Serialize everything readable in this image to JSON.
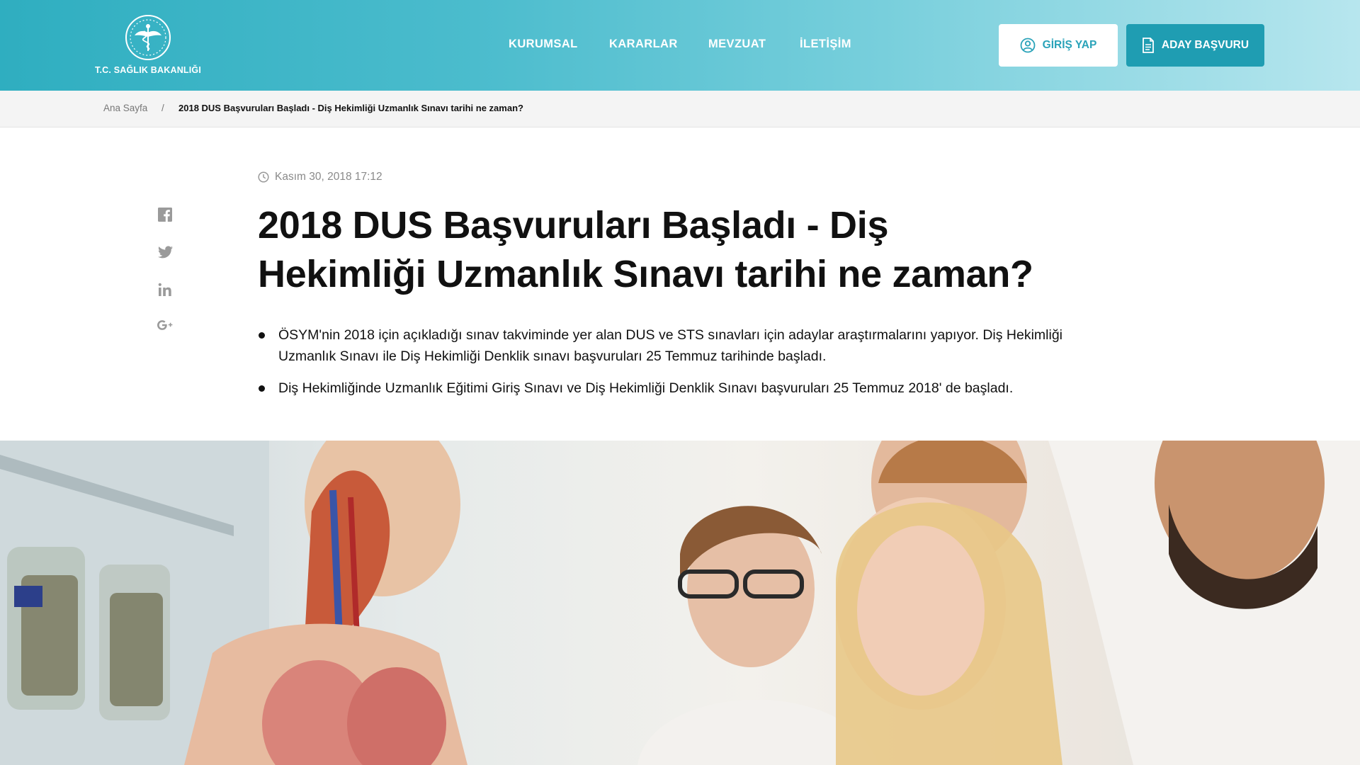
{
  "header": {
    "logo_text": "T.C. SAĞLIK BAKANLIĞI",
    "nav": [
      "KURUMSAL",
      "KARARLAR",
      "MEVZUAT",
      "İLETİŞİM"
    ],
    "login_label": "GİRİŞ YAP",
    "apply_label": "ADAY BAŞVURU"
  },
  "breadcrumb": {
    "home": "Ana Sayfa",
    "separator": "/",
    "current": "2018 DUS Başvuruları Başladı - Diş Hekimliği Uzmanlık Sınavı tarihi ne zaman?"
  },
  "share": [
    "facebook-icon",
    "twitter-icon",
    "linkedin-icon",
    "google-plus-icon"
  ],
  "article": {
    "date": "Kasım 30, 2018 17:12",
    "title": "2018 DUS Başvuruları Başladı - Diş Hekimliği Uzmanlık Sınavı tarihi ne zaman?",
    "bullets": [
      "ÖSYM'nin 2018 için açıkladığı sınav takviminde yer alan DUS ve STS sınavları için adaylar araştırmalarını yapıyor. Diş Hekimliği Uzmanlık Sınavı ile Diş Hekimliği Denklik sınavı başvuruları 25 Temmuz tarihinde başladı.",
      "Diş Hekimliğinde Uzmanlık Eğitimi Giriş Sınavı ve Diş Hekimliği Denklik Sınavı başvuruları 25 Temmuz 2018' de başladı."
    ]
  },
  "colors": {
    "header_start": "#2faec0",
    "header_end": "#b7e6ee",
    "accent": "#1f9db2",
    "login_text": "#2aa3b9"
  }
}
